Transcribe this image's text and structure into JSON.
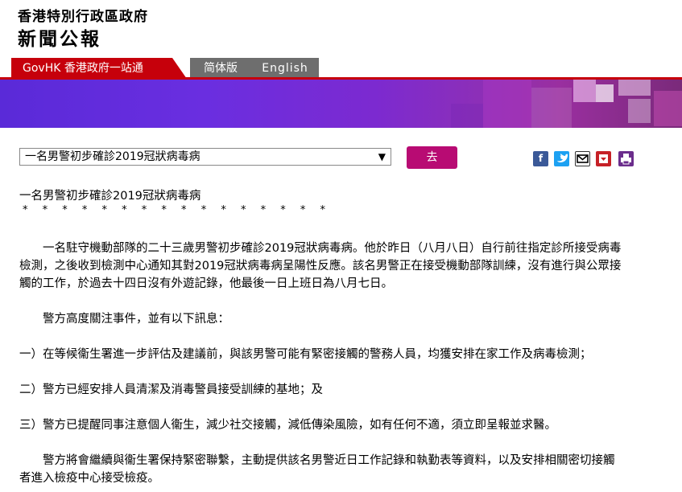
{
  "header": {
    "org_title": "香港特別行政區政府",
    "section_title": "新聞公報"
  },
  "nav": {
    "govhk": "GovHK 香港政府一站通",
    "simplified": "简体版",
    "english": "English"
  },
  "toolbar": {
    "selected_article": "一名男警初步確診2019冠狀病毒病",
    "go_label": "去",
    "share_icons": [
      "facebook-icon",
      "twitter-icon",
      "email-icon",
      "bookmark-icon",
      "print-icon"
    ]
  },
  "article": {
    "title": "一名男警初步確診2019冠狀病毒病",
    "stars": "* * * * * * * * * * * * * * * *",
    "para1_line1": "　　一名駐守機動部隊的二十三歲男警初步確診2019冠狀病毒病。他於昨日（八月八日）自行前往指定診所接受病毒",
    "para1_line2": "檢測，之後收到檢測中心通知其對2019冠狀病毒病呈陽性反應。該名男警正在接受機動部隊訓練，沒有進行與公眾接",
    "para1_line3": "觸的工作，於過去十四日沒有外遊記錄，他最後一日上班日為八月七日。",
    "para2": "　　警方高度關注事件，並有以下訊息：",
    "item1": "一）在等候衞生署進一步評估及建議前，與該男警可能有緊密接觸的警務人員，均獲安排在家工作及病毒檢測；",
    "item2": "二）警方已經安排人員清潔及消毒警員接受訓練的基地；及",
    "item3": "三）警方已提醒同事注意個人衞生，減少社交接觸，減低傳染風險，如有任何不適，須立即呈報並求醫。",
    "para3_line1": "　　警方將會繼續與衞生署保持緊密聯繫，主動提供該名男警近日工作記錄和執勤表等資料，以及安排相關密切接觸",
    "para3_line2": "者進入檢疫中心接受檢疫。"
  },
  "colors": {
    "brand_red": "#c6000b",
    "go_button": "#b80b73",
    "banner_purple": "#5a2ad8"
  }
}
